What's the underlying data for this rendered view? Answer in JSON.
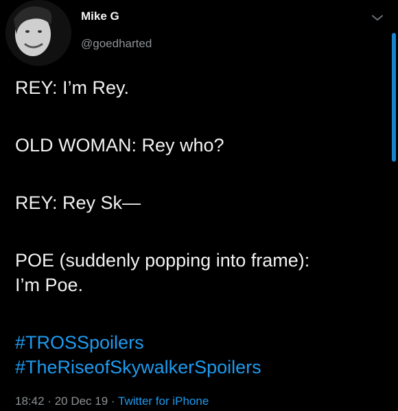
{
  "author": {
    "display_name": "Mike G",
    "handle": "@goedharted"
  },
  "tweet": {
    "lines": [
      "REY: I’m Rey.",
      "OLD WOMAN: Rey who?",
      "REY: Rey Sk—",
      "POE (suddenly popping into frame):",
      "I’m Poe."
    ],
    "hashtags": [
      "#TROSSpoilers",
      "#TheRiseofSkywalkerSpoilers"
    ]
  },
  "meta": {
    "time": "18:42",
    "date": "20 Dec 19",
    "separator": "·",
    "source": "Twitter for iPhone"
  },
  "icons": {
    "menu": "chevron-down-icon",
    "avatar": "user-photo"
  },
  "colors": {
    "background": "#000000",
    "text": "#f2f2f2",
    "secondary": "#8e9296",
    "link": "#1d9bf0"
  }
}
